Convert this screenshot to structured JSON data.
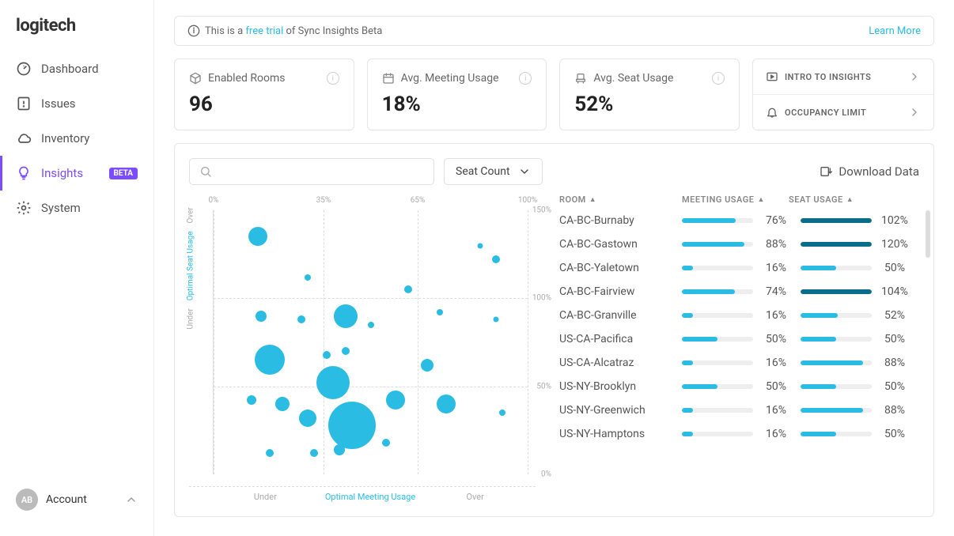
{
  "brand": "logitech",
  "nav": [
    {
      "icon": "gauge",
      "label": "Dashboard"
    },
    {
      "icon": "alert",
      "label": "Issues"
    },
    {
      "icon": "cloud",
      "label": "Inventory"
    },
    {
      "icon": "bulb",
      "label": "Insights",
      "active": true,
      "badge": "BETA"
    },
    {
      "icon": "gear",
      "label": "System"
    }
  ],
  "account": {
    "initials": "AB",
    "label": "Account"
  },
  "banner": {
    "prefix": "This is a ",
    "link": "free trial",
    "suffix": " of Sync Insights Beta",
    "learn": "Learn More"
  },
  "kpis": [
    {
      "label": "Enabled Rooms",
      "value": "96"
    },
    {
      "label": "Avg. Meeting Usage",
      "value": "18%"
    },
    {
      "label": "Avg. Seat Usage",
      "value": "52%"
    }
  ],
  "side_links": [
    {
      "label": "INTRO TO INSIGHTS"
    },
    {
      "label": "OCCUPANCY LIMIT"
    }
  ],
  "chart": {
    "dropdown": "Seat Count",
    "download": "Download Data",
    "xticks": [
      "0%",
      "35%",
      "65%",
      "100%"
    ],
    "yticks": [
      "150%",
      "100%",
      "50%",
      "0%"
    ],
    "xlabels": [
      "Under",
      "Optimal Meeting Usage",
      "Over"
    ],
    "ylabels": [
      "Under",
      "Optimal Seat Usage",
      "Over"
    ]
  },
  "table": {
    "headers": {
      "room": "ROOM",
      "mu": "MEETING USAGE",
      "su": "SEAT USAGE"
    },
    "rows": [
      {
        "room": "CA-BC-Burnaby",
        "mu": 76,
        "su": 102
      },
      {
        "room": "CA-BC-Gastown",
        "mu": 88,
        "su": 120
      },
      {
        "room": "CA-BC-Yaletown",
        "mu": 16,
        "su": 50
      },
      {
        "room": "CA-BC-Fairview",
        "mu": 74,
        "su": 104
      },
      {
        "room": "CA-BC-Granville",
        "mu": 16,
        "su": 52
      },
      {
        "room": "US-CA-Pacifica",
        "mu": 50,
        "su": 50
      },
      {
        "room": "US-CA-Alcatraz",
        "mu": 16,
        "su": 88
      },
      {
        "room": "US-NY-Brooklyn",
        "mu": 50,
        "su": 50
      },
      {
        "room": "US-NY-Greenwich",
        "mu": 16,
        "su": 88
      },
      {
        "room": "US-NY-Hamptons",
        "mu": 16,
        "su": 50
      }
    ]
  },
  "chart_data": {
    "type": "scatter",
    "title": "Room seat usage vs meeting usage (bubble size = seat count)",
    "xlabel": "Meeting Usage (%)",
    "ylabel": "Seat Usage (%)",
    "xlim": [
      0,
      100
    ],
    "ylim": [
      0,
      150
    ],
    "x_regions": [
      {
        "label": "Under",
        "range": [
          0,
          35
        ]
      },
      {
        "label": "Optimal",
        "range": [
          35,
          65
        ]
      },
      {
        "label": "Over",
        "range": [
          65,
          100
        ]
      }
    ],
    "y_regions": [
      {
        "label": "Under",
        "range": [
          0,
          50
        ]
      },
      {
        "label": "Optimal",
        "range": [
          50,
          100
        ]
      },
      {
        "label": "Over",
        "range": [
          100,
          150
        ]
      }
    ],
    "points": [
      {
        "x": 14,
        "y": 135,
        "size": 24
      },
      {
        "x": 30,
        "y": 112,
        "size": 8
      },
      {
        "x": 62,
        "y": 105,
        "size": 10
      },
      {
        "x": 85,
        "y": 130,
        "size": 7
      },
      {
        "x": 90,
        "y": 122,
        "size": 10
      },
      {
        "x": 15,
        "y": 90,
        "size": 14
      },
      {
        "x": 28,
        "y": 88,
        "size": 10
      },
      {
        "x": 42,
        "y": 90,
        "size": 30
      },
      {
        "x": 50,
        "y": 85,
        "size": 8
      },
      {
        "x": 58,
        "y": 42,
        "size": 24
      },
      {
        "x": 72,
        "y": 92,
        "size": 8
      },
      {
        "x": 90,
        "y": 88,
        "size": 7
      },
      {
        "x": 18,
        "y": 65,
        "size": 38
      },
      {
        "x": 36,
        "y": 68,
        "size": 10
      },
      {
        "x": 38,
        "y": 52,
        "size": 42
      },
      {
        "x": 42,
        "y": 70,
        "size": 10
      },
      {
        "x": 68,
        "y": 62,
        "size": 16
      },
      {
        "x": 12,
        "y": 42,
        "size": 12
      },
      {
        "x": 22,
        "y": 40,
        "size": 18
      },
      {
        "x": 30,
        "y": 32,
        "size": 22
      },
      {
        "x": 44,
        "y": 28,
        "size": 60
      },
      {
        "x": 74,
        "y": 40,
        "size": 24
      },
      {
        "x": 92,
        "y": 35,
        "size": 8
      },
      {
        "x": 18,
        "y": 12,
        "size": 10
      },
      {
        "x": 32,
        "y": 12,
        "size": 10
      },
      {
        "x": 40,
        "y": 14,
        "size": 14
      },
      {
        "x": 55,
        "y": 18,
        "size": 10
      }
    ]
  }
}
